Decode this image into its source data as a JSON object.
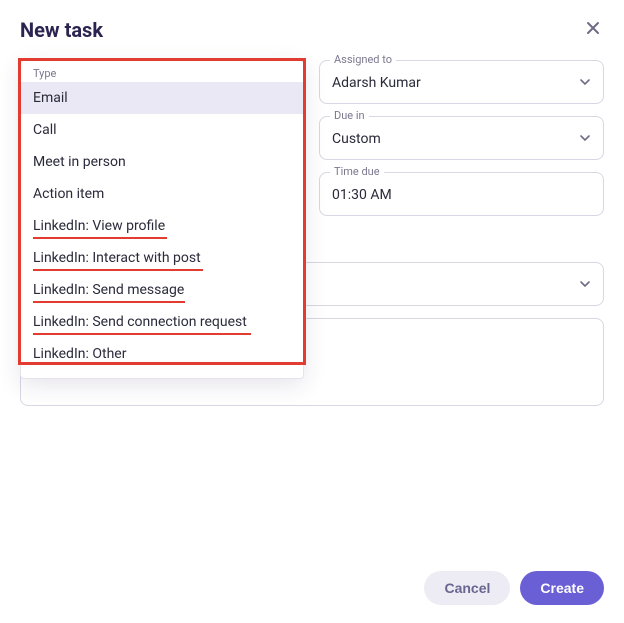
{
  "header": {
    "title": "New task"
  },
  "type_field": {
    "label": "Type",
    "options": [
      {
        "label": "Email",
        "selected": true,
        "underline": null
      },
      {
        "label": "Call",
        "selected": false,
        "underline": null
      },
      {
        "label": "Meet in person",
        "selected": false,
        "underline": null
      },
      {
        "label": "Action item",
        "selected": false,
        "underline": null
      },
      {
        "label": "LinkedIn: View profile",
        "selected": false,
        "underline": "ul1"
      },
      {
        "label": "LinkedIn: Interact with post",
        "selected": false,
        "underline": "ul2"
      },
      {
        "label": "LinkedIn: Send message",
        "selected": false,
        "underline": "ul3"
      },
      {
        "label": "LinkedIn: Send connection request",
        "selected": false,
        "underline": "ul4"
      },
      {
        "label": "LinkedIn: Other",
        "selected": false,
        "underline": null
      }
    ]
  },
  "assigned_to": {
    "label": "Assigned to",
    "value": "Adarsh Kumar"
  },
  "due_in": {
    "label": "Due in",
    "value": "Custom"
  },
  "time_due": {
    "label": "Time due",
    "value": "01:30 AM"
  },
  "extra_select": {
    "value": ""
  },
  "footer": {
    "cancel": "Cancel",
    "create": "Create"
  }
}
